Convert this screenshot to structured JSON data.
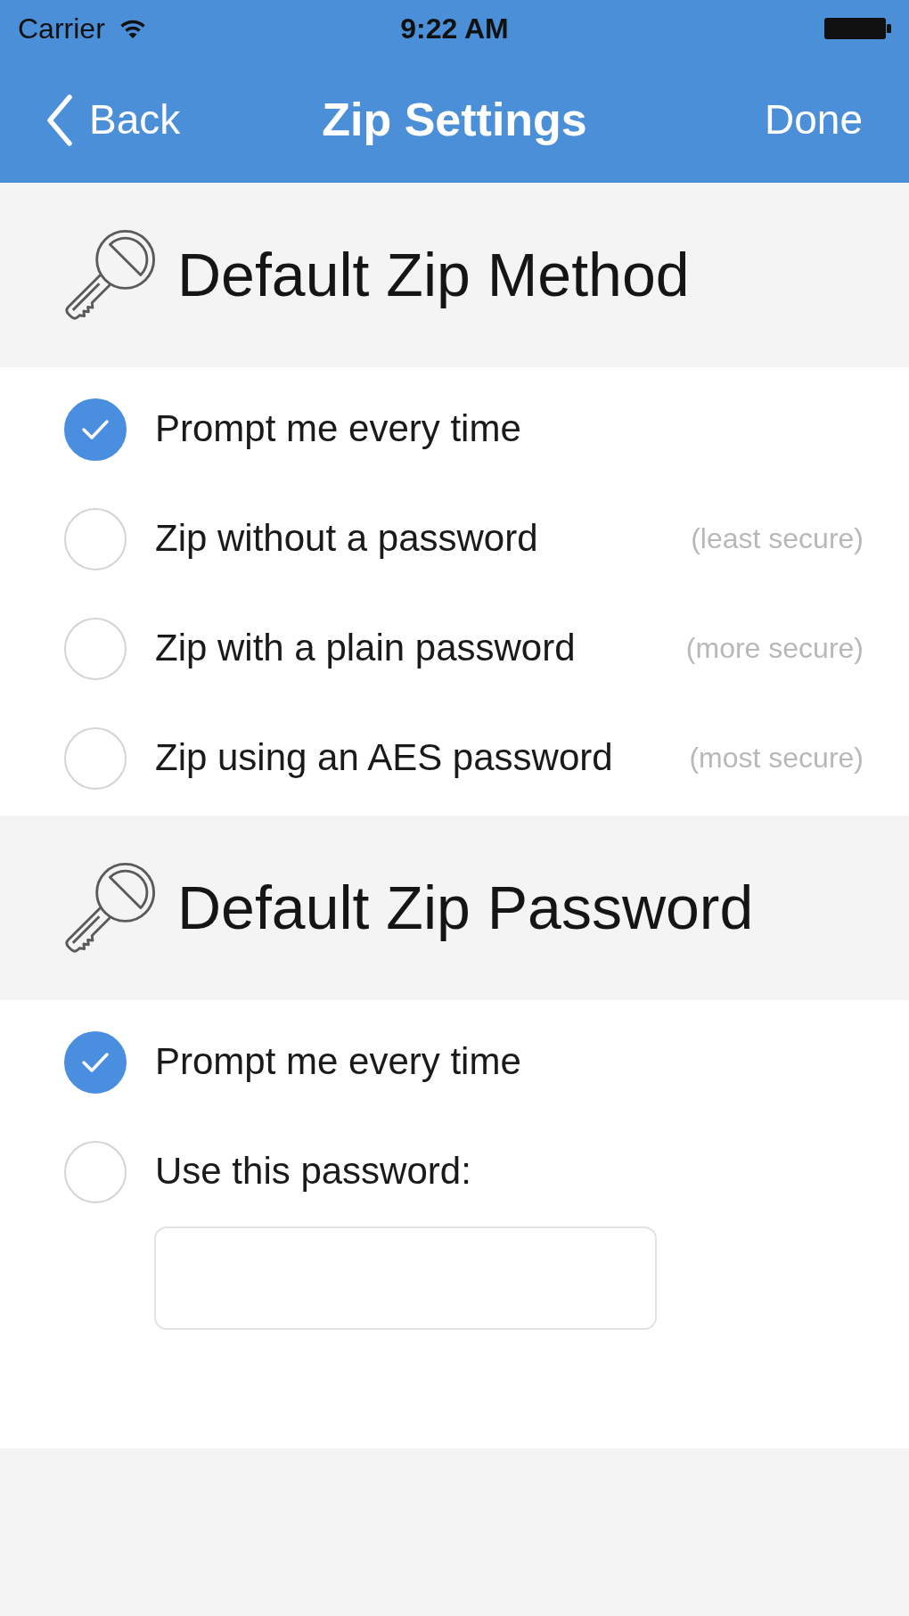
{
  "status_bar": {
    "carrier": "Carrier",
    "time": "9:22 AM"
  },
  "nav_bar": {
    "back": "Back",
    "title": "Zip Settings",
    "done": "Done"
  },
  "sections": [
    {
      "title": "Default Zip Method",
      "options": [
        {
          "kind": "choice",
          "label": "Prompt me every time",
          "selected": true
        },
        {
          "kind": "choice",
          "label": "Zip without a password",
          "hint": "(least secure)",
          "selected": false
        },
        {
          "kind": "choice",
          "label": "Zip with a plain password",
          "hint": "(more secure)",
          "selected": false
        },
        {
          "kind": "choice",
          "label": "Zip using an AES password",
          "hint": "(most secure)",
          "selected": false
        }
      ]
    },
    {
      "title": "Default Zip Password",
      "options": [
        {
          "kind": "choice",
          "label": "Prompt me every time",
          "selected": true
        },
        {
          "kind": "choice_with_field",
          "label": "Use this password:",
          "selected": false
        }
      ]
    }
  ]
}
